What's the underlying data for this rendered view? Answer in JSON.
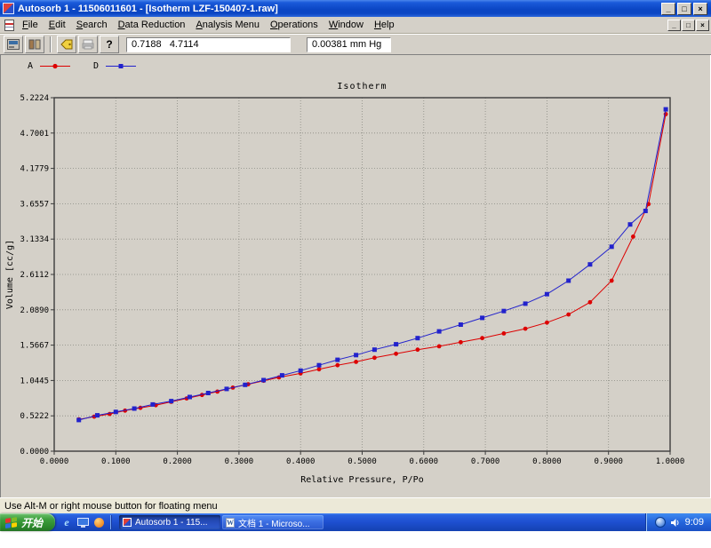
{
  "window": {
    "title": "Autosorb 1 - 11506011601 - [Isotherm LZF-150407-1.raw]",
    "minimize_glyph": "_",
    "maximize_glyph": "□",
    "close_glyph": "×"
  },
  "menu": {
    "items": [
      {
        "label": "File"
      },
      {
        "label": "Edit"
      },
      {
        "label": "Search"
      },
      {
        "label": "Data Reduction"
      },
      {
        "label": "Analysis Menu"
      },
      {
        "label": "Operations"
      },
      {
        "label": "Window"
      },
      {
        "label": "Help"
      }
    ]
  },
  "icons": {
    "help_glyph": "?",
    "ie_glyph": "e",
    "word_glyph": "W"
  },
  "toolbar": {
    "readout_field": "0.7188   4.7114",
    "pressure_field": "0.00381 mm Hg"
  },
  "statusbar": {
    "text": "Use Alt-M or right mouse button for floating menu"
  },
  "taskbar": {
    "start_label": "开始",
    "tasks": [
      {
        "label": "Autosorb 1 - 115...",
        "active": true,
        "icon": "autosorb-icon"
      },
      {
        "label": "文档 1 - Microso...",
        "active": false,
        "icon": "word-icon"
      }
    ],
    "clock": "9:09"
  },
  "chart_data": {
    "type": "line",
    "title": "Isotherm",
    "xlabel": "Relative Pressure, P/Po",
    "ylabel": "Volume [cc/g]",
    "xlim": [
      0,
      1
    ],
    "ylim": [
      0,
      5.2224
    ],
    "grid": true,
    "legend_position": "top-left",
    "xticks": [
      "0.0000",
      "0.1000",
      "0.2000",
      "0.3000",
      "0.4000",
      "0.5000",
      "0.6000",
      "0.7000",
      "0.8000",
      "0.9000",
      "1.0000"
    ],
    "yticks": [
      "0.0000",
      "0.5222",
      "1.0445",
      "1.5667",
      "2.0890",
      "2.6112",
      "3.1334",
      "3.6557",
      "4.1779",
      "4.7001",
      "5.2224"
    ],
    "series": [
      {
        "name": "A",
        "marker": "circle",
        "color": "#dd0000",
        "x": [
          0.04,
          0.065,
          0.09,
          0.115,
          0.14,
          0.165,
          0.19,
          0.215,
          0.24,
          0.265,
          0.29,
          0.315,
          0.34,
          0.365,
          0.4,
          0.43,
          0.46,
          0.49,
          0.52,
          0.555,
          0.59,
          0.625,
          0.66,
          0.695,
          0.73,
          0.765,
          0.8,
          0.835,
          0.87,
          0.905,
          0.94,
          0.965,
          0.993
        ],
        "y": [
          0.47,
          0.51,
          0.55,
          0.6,
          0.64,
          0.68,
          0.73,
          0.78,
          0.83,
          0.88,
          0.94,
          0.99,
          1.04,
          1.09,
          1.15,
          1.21,
          1.27,
          1.32,
          1.38,
          1.44,
          1.5,
          1.55,
          1.61,
          1.67,
          1.74,
          1.81,
          1.9,
          2.02,
          2.2,
          2.52,
          3.17,
          3.65,
          4.98
        ]
      },
      {
        "name": "D",
        "marker": "square",
        "color": "#2222cc",
        "x": [
          0.04,
          0.07,
          0.1,
          0.13,
          0.16,
          0.19,
          0.22,
          0.25,
          0.28,
          0.31,
          0.34,
          0.37,
          0.4,
          0.43,
          0.46,
          0.49,
          0.52,
          0.555,
          0.59,
          0.625,
          0.66,
          0.695,
          0.73,
          0.765,
          0.8,
          0.835,
          0.87,
          0.905,
          0.935,
          0.96,
          0.993
        ],
        "y": [
          0.46,
          0.53,
          0.58,
          0.63,
          0.69,
          0.74,
          0.8,
          0.86,
          0.92,
          0.98,
          1.05,
          1.12,
          1.19,
          1.27,
          1.35,
          1.42,
          1.5,
          1.58,
          1.67,
          1.77,
          1.87,
          1.97,
          2.07,
          2.18,
          2.32,
          2.52,
          2.76,
          3.02,
          3.35,
          3.55,
          5.05
        ]
      }
    ]
  }
}
